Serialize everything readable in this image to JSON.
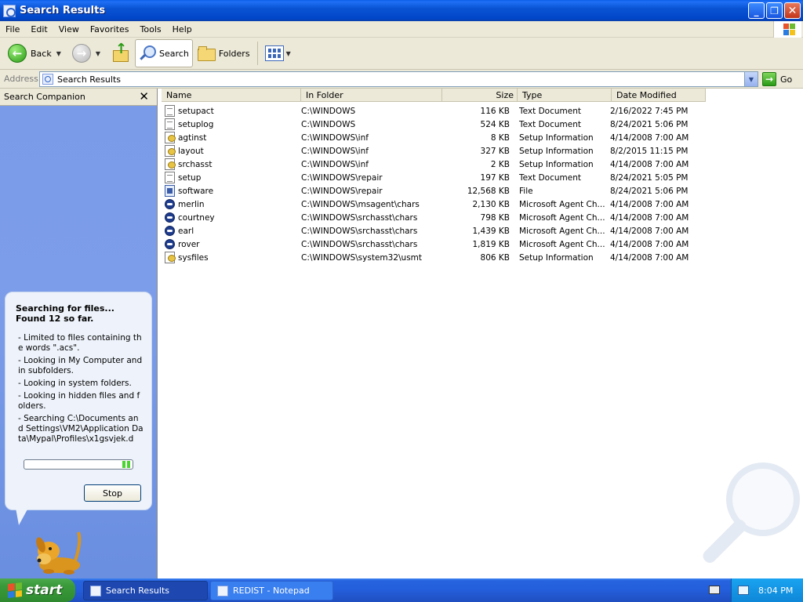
{
  "window": {
    "title": "Search Results",
    "controls": {
      "minimize": "_",
      "maximize": "❐",
      "close": "✕"
    }
  },
  "menu": [
    "File",
    "Edit",
    "View",
    "Favorites",
    "Tools",
    "Help"
  ],
  "toolbar": {
    "back": "Back",
    "search": "Search",
    "folders": "Folders"
  },
  "address": {
    "label": "Address",
    "value": "Search Results",
    "go": "Go"
  },
  "sidebar": {
    "title": "Search Companion",
    "close": "✕",
    "status_title": "Searching for files...  Found 12 so far.",
    "status_lines": [
      "- Limited to files containing the words \".acs\".",
      "- Looking in My Computer and in subfolders.",
      "- Looking in system folders.",
      "- Looking in hidden files and folders.",
      "- Searching C:\\Documents and Settings\\VM2\\Application Data\\Mypal\\Profiles\\x1gsvjek.d"
    ],
    "stop": "Stop"
  },
  "columns": {
    "name": "Name",
    "folder": "In Folder",
    "size": "Size",
    "type": "Type",
    "date": "Date Modified"
  },
  "files": [
    {
      "icon": "text",
      "name": "setupact",
      "folder": "C:\\WINDOWS",
      "size": "116 KB",
      "type": "Text Document",
      "date": "2/16/2022 7:45 PM"
    },
    {
      "icon": "text",
      "name": "setuplog",
      "folder": "C:\\WINDOWS",
      "size": "524 KB",
      "type": "Text Document",
      "date": "8/24/2021 5:06 PM"
    },
    {
      "icon": "setup",
      "name": "agtinst",
      "folder": "C:\\WINDOWS\\inf",
      "size": "8 KB",
      "type": "Setup Information",
      "date": "4/14/2008 7:00 AM"
    },
    {
      "icon": "setup",
      "name": "layout",
      "folder": "C:\\WINDOWS\\inf",
      "size": "327 KB",
      "type": "Setup Information",
      "date": "8/2/2015 11:15 PM"
    },
    {
      "icon": "setup",
      "name": "srchasst",
      "folder": "C:\\WINDOWS\\inf",
      "size": "2 KB",
      "type": "Setup Information",
      "date": "4/14/2008 7:00 AM"
    },
    {
      "icon": "text",
      "name": "setup",
      "folder": "C:\\WINDOWS\\repair",
      "size": "197 KB",
      "type": "Text Document",
      "date": "8/24/2021 5:05 PM"
    },
    {
      "icon": "file",
      "name": "software",
      "folder": "C:\\WINDOWS\\repair",
      "size": "12,568 KB",
      "type": "File",
      "date": "8/24/2021 5:06 PM"
    },
    {
      "icon": "agent",
      "name": "merlin",
      "folder": "C:\\WINDOWS\\msagent\\chars",
      "size": "2,130 KB",
      "type": "Microsoft Agent Ch...",
      "date": "4/14/2008 7:00 AM"
    },
    {
      "icon": "agent",
      "name": "courtney",
      "folder": "C:\\WINDOWS\\srchasst\\chars",
      "size": "798 KB",
      "type": "Microsoft Agent Ch...",
      "date": "4/14/2008 7:00 AM"
    },
    {
      "icon": "agent",
      "name": "earl",
      "folder": "C:\\WINDOWS\\srchasst\\chars",
      "size": "1,439 KB",
      "type": "Microsoft Agent Ch...",
      "date": "4/14/2008 7:00 AM"
    },
    {
      "icon": "agent",
      "name": "rover",
      "folder": "C:\\WINDOWS\\srchasst\\chars",
      "size": "1,819 KB",
      "type": "Microsoft Agent Ch...",
      "date": "4/14/2008 7:00 AM"
    },
    {
      "icon": "setup",
      "name": "sysfiles",
      "folder": "C:\\WINDOWS\\system32\\usmt",
      "size": "806 KB",
      "type": "Setup Information",
      "date": "4/14/2008 7:00 AM"
    }
  ],
  "taskbar": {
    "start": "start",
    "tasks": [
      "Search Results",
      "REDIST - Notepad"
    ],
    "clock": "8:04 PM"
  }
}
